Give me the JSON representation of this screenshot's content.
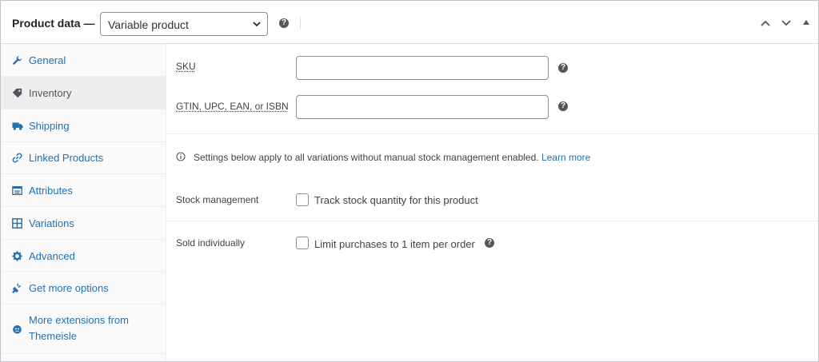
{
  "header": {
    "title": "Product data —",
    "product_type": {
      "selected": "Variable product"
    },
    "help_icon": "question-circle-icon",
    "controls": [
      "move-up-icon",
      "move-down-icon",
      "collapse-toggle-icon"
    ]
  },
  "sidebar": {
    "items": [
      {
        "label": "General",
        "icon": "wrench-icon",
        "active": false
      },
      {
        "label": "Inventory",
        "icon": "tag-icon",
        "active": true
      },
      {
        "label": "Shipping",
        "icon": "truck-icon",
        "active": false
      },
      {
        "label": "Linked Products",
        "icon": "link-icon",
        "active": false
      },
      {
        "label": "Attributes",
        "icon": "list-icon",
        "active": false
      },
      {
        "label": "Variations",
        "icon": "grid-icon",
        "active": false
      },
      {
        "label": "Advanced",
        "icon": "gear-icon",
        "active": false
      },
      {
        "label": "Get more options",
        "icon": "plugin-icon",
        "active": false
      },
      {
        "label": "More extensions from Themeisle",
        "icon": "themeisle-icon",
        "active": false
      }
    ]
  },
  "inventory": {
    "sku": {
      "label": "SKU",
      "value": ""
    },
    "gtin": {
      "label": "GTIN, UPC, EAN, or ISBN",
      "value": ""
    },
    "notice": {
      "text": "Settings below apply to all variations without manual stock management enabled.",
      "link": "Learn more"
    },
    "stock_management": {
      "label": "Stock management",
      "checkbox_label": "Track stock quantity for this product",
      "checked": false
    },
    "sold_individually": {
      "label": "Sold individually",
      "checkbox_label": "Limit purchases to 1 item per order",
      "checked": false
    }
  },
  "colors": {
    "link": "#2271b1",
    "text": "#3c434a",
    "border": "#8c8f94",
    "active_tab_bg": "#eeeeee"
  }
}
